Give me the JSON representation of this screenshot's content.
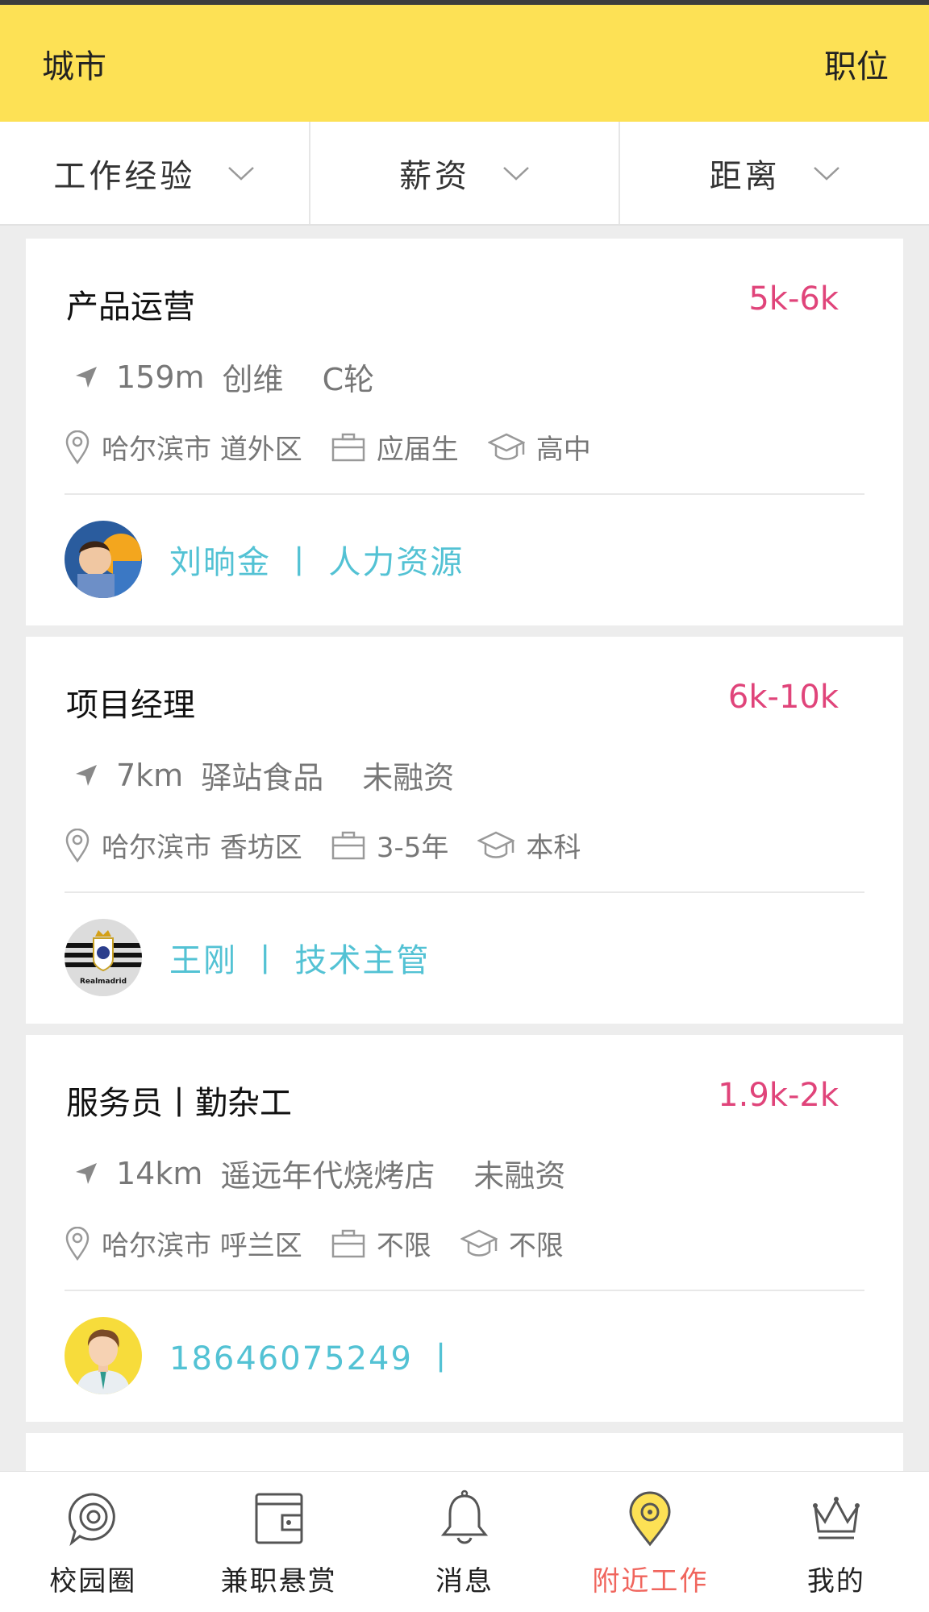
{
  "colors": {
    "header_bg": "#fde155",
    "salary": "#e0447a",
    "contact": "#53c2d4",
    "nav_active": "#f0655d"
  },
  "header": {
    "left_label": "城市",
    "right_label": "职位"
  },
  "filters": [
    {
      "label": "工作经验",
      "icon": "chevron-down-icon"
    },
    {
      "label": "薪资",
      "icon": "chevron-down-icon"
    },
    {
      "label": "距离",
      "icon": "chevron-down-icon"
    }
  ],
  "jobs": [
    {
      "title": "产品运营",
      "salary": "5k-6k",
      "distance": "159m",
      "company": "创维",
      "funding": "C轮",
      "location": "哈尔滨市 道外区",
      "experience": "应届生",
      "education": "高中",
      "contact": "刘晌金 丨 人力资源",
      "avatar": "child-photo-avatar"
    },
    {
      "title": "项目经理",
      "salary": "6k-10k",
      "distance": "7km",
      "company": "驿站食品",
      "funding": "未融资",
      "location": "哈尔滨市 香坊区",
      "experience": "3-5年",
      "education": "本科",
      "contact": "王刚 丨 技术主管",
      "avatar": "realmadrid-logo-avatar",
      "avatar_text": "Realmadrid"
    },
    {
      "title": "服务员丨勤杂工",
      "salary": "1.9k-2k",
      "distance": "14km",
      "company": "遥远年代烧烤店",
      "funding": "未融资",
      "location": "哈尔滨市 呼兰区",
      "experience": "不限",
      "education": "不限",
      "contact": "18646075249 丨",
      "avatar": "cartoon-man-avatar"
    }
  ],
  "nav": [
    {
      "label": "校园圈",
      "icon": "camera-bubble-icon",
      "active": false
    },
    {
      "label": "兼职悬赏",
      "icon": "wallet-icon",
      "active": false
    },
    {
      "label": "消息",
      "icon": "bell-icon",
      "active": false
    },
    {
      "label": "附近工作",
      "icon": "location-pin-icon",
      "active": true
    },
    {
      "label": "我的",
      "icon": "crown-icon",
      "active": false
    }
  ]
}
